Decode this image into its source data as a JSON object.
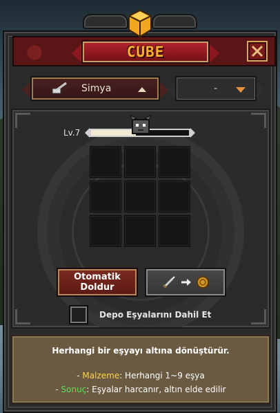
{
  "window": {
    "title": "CUBE",
    "close_icon": "close-x-icon"
  },
  "category_select": {
    "icon": "alchemy-pestle-icon",
    "label": "Simya",
    "arrow": "triangle-up-icon"
  },
  "sub_select": {
    "label": "-",
    "arrow": "triangle-down-icon"
  },
  "level": {
    "label": "Lv.7",
    "progress_fraction": 0.46
  },
  "craft_grid": {
    "slots": [
      "",
      "",
      "",
      "",
      "",
      "",
      "",
      "",
      ""
    ]
  },
  "buttons": {
    "auto_fill_line1": "Otomatik",
    "auto_fill_line2": "Doldur",
    "convert_icons": [
      "sword-icon",
      "arrow-right-icon",
      "gold-coin-icon"
    ]
  },
  "checkbox": {
    "label": "Depo Eşyalarını Dahil Et",
    "checked": false
  },
  "info": {
    "description": "Herhangi bir eşyayı altına dönüştürür.",
    "material_prefix": "- ",
    "material_key": "Malzeme",
    "material_value": ": Herhangi 1~9 eşya",
    "result_prefix": "- ",
    "result_key": "Sonuç",
    "result_value": ": Eşyalar harcanır, altın elde edilir"
  },
  "colors": {
    "title_text": "#ffb02e",
    "material_key": "#ffd54a",
    "result_key": "#5ce05c",
    "accent_red": "#8d1820"
  }
}
